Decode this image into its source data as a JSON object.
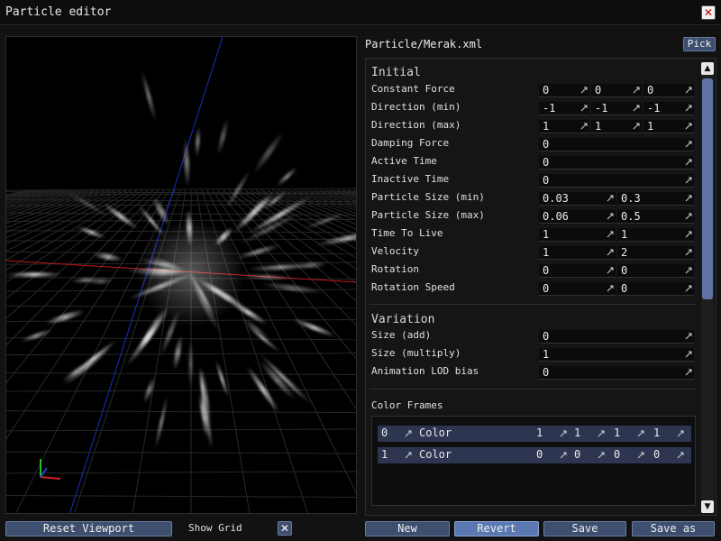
{
  "window": {
    "title": "Particle editor",
    "close_icon": "close-icon"
  },
  "viewport": {
    "reset_label": "Reset Viewport",
    "show_grid_label": "Show Grid",
    "show_grid_checked": true
  },
  "file": {
    "path": "Particle/Merak.xml",
    "pick_label": "Pick"
  },
  "initial": {
    "title": "Initial",
    "rows": [
      {
        "label": "Constant Force",
        "values": [
          "0",
          "0",
          "0"
        ]
      },
      {
        "label": "Direction (min)",
        "values": [
          "-1",
          "-1",
          "-1"
        ]
      },
      {
        "label": "Direction (max)",
        "values": [
          "1",
          "1",
          "1"
        ]
      },
      {
        "label": "Damping Force",
        "values": [
          "0"
        ]
      },
      {
        "label": "Active Time",
        "values": [
          "0"
        ]
      },
      {
        "label": "Inactive Time",
        "values": [
          "0"
        ]
      },
      {
        "label": "Particle Size (min)",
        "values": [
          "0.03",
          "0.3"
        ]
      },
      {
        "label": "Particle Size (max)",
        "values": [
          "0.06",
          "0.5"
        ]
      },
      {
        "label": "Time To Live",
        "values": [
          "1",
          "1"
        ]
      },
      {
        "label": "Velocity",
        "values": [
          "1",
          "2"
        ]
      },
      {
        "label": "Rotation",
        "values": [
          "0",
          "0"
        ]
      },
      {
        "label": "Rotation Speed",
        "values": [
          "0",
          "0"
        ]
      }
    ]
  },
  "variation": {
    "title": "Variation",
    "rows": [
      {
        "label": "Size (add)",
        "values": [
          "0"
        ]
      },
      {
        "label": "Size (multiply)",
        "values": [
          "1"
        ]
      },
      {
        "label": "Animation LOD bias",
        "values": [
          "0"
        ]
      }
    ]
  },
  "color_frames": {
    "label": "Color Frames",
    "frames": [
      {
        "index": "0",
        "name": "Color",
        "values": [
          "1",
          "1",
          "1",
          "1"
        ]
      },
      {
        "index": "1",
        "name": "Color",
        "values": [
          "0",
          "0",
          "0",
          "0"
        ]
      }
    ]
  },
  "actions": {
    "new": "New",
    "revert": "Revert",
    "save": "Save",
    "save_as": "Save as"
  },
  "colors": {
    "button": "#3e4e6e",
    "button_active": "#5a79b2",
    "scroll_thumb": "#6274a6",
    "axis_x": "#d02020",
    "axis_y": "#20c020",
    "axis_z": "#2040d0"
  }
}
